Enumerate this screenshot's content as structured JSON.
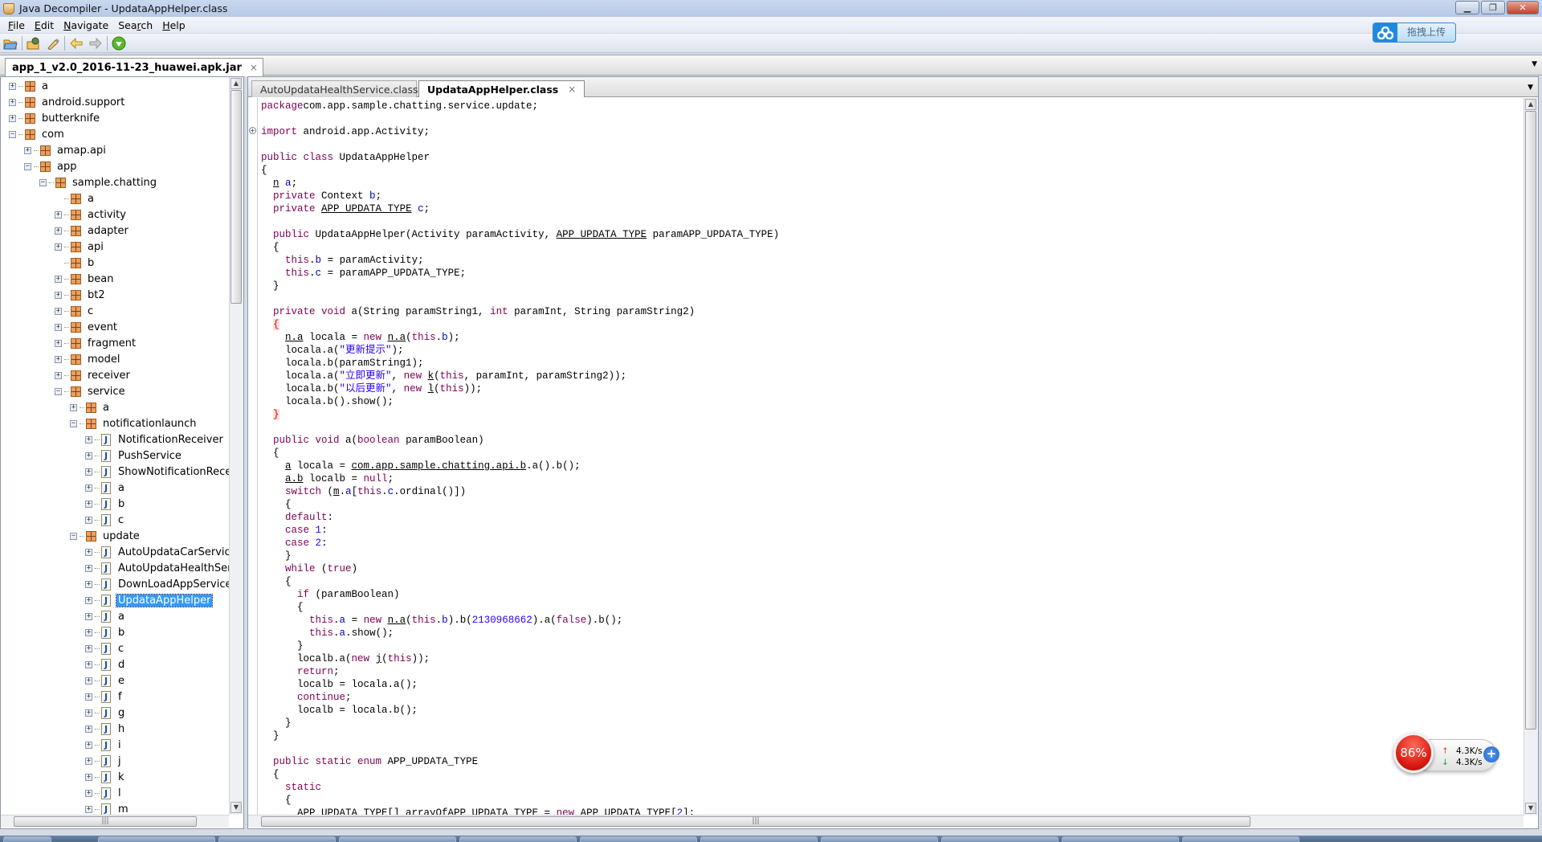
{
  "window": {
    "title": "Java Decompiler - UpdataAppHelper.class",
    "min": "▁",
    "restore": "❐",
    "close": "✕"
  },
  "menu": [
    {
      "mn": "F",
      "rest": "ile"
    },
    {
      "mn": "E",
      "rest": "dit"
    },
    {
      "mn": "N",
      "rest": "avigate"
    },
    {
      "pre": "Sea",
      "mn": "r",
      "rest": "ch"
    },
    {
      "mn": "H",
      "rest": "elp"
    }
  ],
  "toolbar": [
    "open-file-icon",
    "open-type-icon",
    "search-icon",
    "back-icon",
    "forward-icon",
    "jd-online-icon"
  ],
  "upload_widget": {
    "label": "拖拽上传"
  },
  "outer_tab": {
    "label": "app_1_v2.0_2016-11-23_huawei.apk.jar",
    "close": "×"
  },
  "tree": [
    {
      "l": 0,
      "t": "pkg",
      "e": "+",
      "label": "a"
    },
    {
      "l": 0,
      "t": "pkg",
      "e": "+",
      "label": "android.support"
    },
    {
      "l": 0,
      "t": "pkg",
      "e": "+",
      "label": "butterknife"
    },
    {
      "l": 0,
      "t": "pkg",
      "e": "-",
      "label": "com"
    },
    {
      "l": 1,
      "t": "pkg",
      "e": "+",
      "label": "amap.api"
    },
    {
      "l": 1,
      "t": "pkg",
      "e": "-",
      "label": "app"
    },
    {
      "l": 2,
      "t": "pkg",
      "e": "-",
      "label": "sample.chatting"
    },
    {
      "l": 3,
      "t": "pkg",
      "e": "",
      "label": "a"
    },
    {
      "l": 3,
      "t": "pkg",
      "e": "+",
      "label": "activity"
    },
    {
      "l": 3,
      "t": "pkg",
      "e": "+",
      "label": "adapter"
    },
    {
      "l": 3,
      "t": "pkg",
      "e": "+",
      "label": "api"
    },
    {
      "l": 3,
      "t": "pkg",
      "e": "",
      "label": "b"
    },
    {
      "l": 3,
      "t": "pkg",
      "e": "+",
      "label": "bean"
    },
    {
      "l": 3,
      "t": "pkg",
      "e": "+",
      "label": "bt2"
    },
    {
      "l": 3,
      "t": "pkg",
      "e": "+",
      "label": "c"
    },
    {
      "l": 3,
      "t": "pkg",
      "e": "+",
      "label": "event"
    },
    {
      "l": 3,
      "t": "pkg",
      "e": "+",
      "label": "fragment"
    },
    {
      "l": 3,
      "t": "pkg",
      "e": "+",
      "label": "model"
    },
    {
      "l": 3,
      "t": "pkg",
      "e": "+",
      "label": "receiver"
    },
    {
      "l": 3,
      "t": "pkg",
      "e": "-",
      "label": "service"
    },
    {
      "l": 4,
      "t": "pkg",
      "e": "+",
      "label": "a"
    },
    {
      "l": 4,
      "t": "pkg",
      "e": "-",
      "label": "notificationlaunch"
    },
    {
      "l": 5,
      "t": "cls",
      "e": "+",
      "label": "NotificationReceiver"
    },
    {
      "l": 5,
      "t": "cls",
      "e": "+",
      "label": "PushService"
    },
    {
      "l": 5,
      "t": "cls",
      "e": "+",
      "label": "ShowNotificationReceive"
    },
    {
      "l": 5,
      "t": "cls",
      "e": "+",
      "label": "a"
    },
    {
      "l": 5,
      "t": "cls",
      "e": "+",
      "label": "b"
    },
    {
      "l": 5,
      "t": "cls",
      "e": "+",
      "label": "c"
    },
    {
      "l": 4,
      "t": "pkg",
      "e": "-",
      "label": "update"
    },
    {
      "l": 5,
      "t": "cls",
      "e": "+",
      "label": "AutoUpdataCarService"
    },
    {
      "l": 5,
      "t": "cls",
      "e": "+",
      "label": "AutoUpdataHealthServic"
    },
    {
      "l": 5,
      "t": "cls",
      "e": "+",
      "label": "DownLoadAppService"
    },
    {
      "l": 5,
      "t": "cls",
      "e": "+",
      "label": "UpdataAppHelper",
      "selected": true
    },
    {
      "l": 5,
      "t": "cls",
      "e": "+",
      "label": "a"
    },
    {
      "l": 5,
      "t": "cls",
      "e": "+",
      "label": "b"
    },
    {
      "l": 5,
      "t": "cls",
      "e": "+",
      "label": "c"
    },
    {
      "l": 5,
      "t": "cls",
      "e": "+",
      "label": "d"
    },
    {
      "l": 5,
      "t": "cls",
      "e": "+",
      "label": "e"
    },
    {
      "l": 5,
      "t": "cls",
      "e": "+",
      "label": "f"
    },
    {
      "l": 5,
      "t": "cls",
      "e": "+",
      "label": "g"
    },
    {
      "l": 5,
      "t": "cls",
      "e": "+",
      "label": "h"
    },
    {
      "l": 5,
      "t": "cls",
      "e": "+",
      "label": "i"
    },
    {
      "l": 5,
      "t": "cls",
      "e": "+",
      "label": "j"
    },
    {
      "l": 5,
      "t": "cls",
      "e": "+",
      "label": "k"
    },
    {
      "l": 5,
      "t": "cls",
      "e": "+",
      "label": "l"
    },
    {
      "l": 5,
      "t": "cls",
      "e": "+",
      "label": "m"
    }
  ],
  "editor_tabs": [
    {
      "label": "AutoUpdataHealthService.class",
      "active": false
    },
    {
      "label": "UpdataAppHelper.class",
      "active": true,
      "close": "×"
    }
  ],
  "code_colors": {
    "keyword": "#7f0055",
    "field": "#0000c0",
    "string": "#2a00ff"
  },
  "code": [
    [
      [
        "k",
        "package"
      ],
      [
        "",
        "com.app.sample.chatting.service.update;"
      ]
    ],
    [],
    [
      [
        "k",
        "import"
      ],
      [
        "",
        " android.app.Activity;"
      ]
    ],
    [],
    [
      [
        "k",
        "public class"
      ],
      [
        "",
        " UpdataAppHelper"
      ]
    ],
    [
      [
        "",
        "{"
      ]
    ],
    [
      [
        "",
        "  "
      ],
      [
        "u",
        "n"
      ],
      [
        "",
        " "
      ],
      [
        "f",
        "a"
      ],
      [
        "",
        ";"
      ]
    ],
    [
      [
        "",
        "  "
      ],
      [
        "k",
        "private"
      ],
      [
        "",
        " Context "
      ],
      [
        "f",
        "b"
      ],
      [
        "",
        ";"
      ]
    ],
    [
      [
        "",
        "  "
      ],
      [
        "k",
        "private"
      ],
      [
        "",
        " "
      ],
      [
        "u",
        "APP_UPDATA_TYPE"
      ],
      [
        "",
        " "
      ],
      [
        "f",
        "c"
      ],
      [
        "",
        ";"
      ]
    ],
    [],
    [
      [
        "",
        "  "
      ],
      [
        "k",
        "public"
      ],
      [
        "",
        " UpdataAppHelper(Activity paramActivity, "
      ],
      [
        "u",
        "APP_UPDATA_TYPE"
      ],
      [
        "",
        " paramAPP_UPDATA_TYPE)"
      ]
    ],
    [
      [
        "",
        "  {"
      ]
    ],
    [
      [
        "",
        "    "
      ],
      [
        "k",
        "this"
      ],
      [
        "",
        "."
      ],
      [
        "f",
        "b"
      ],
      [
        "",
        " = paramActivity;"
      ]
    ],
    [
      [
        "",
        "    "
      ],
      [
        "k",
        "this"
      ],
      [
        "",
        "."
      ],
      [
        "f",
        "c"
      ],
      [
        "",
        " = paramAPP_UPDATA_TYPE;"
      ]
    ],
    [
      [
        "",
        "  }"
      ]
    ],
    [],
    [
      [
        "",
        "  "
      ],
      [
        "k",
        "private void"
      ],
      [
        "",
        " a(String paramString1, "
      ],
      [
        "k",
        "int"
      ],
      [
        "",
        " paramInt, String paramString2)"
      ]
    ],
    [
      [
        "",
        "  "
      ],
      [
        "rb",
        "{"
      ]
    ],
    [
      [
        "",
        "    "
      ],
      [
        "u",
        "n.a"
      ],
      [
        "",
        " locala = "
      ],
      [
        "k",
        "new"
      ],
      [
        "",
        " "
      ],
      [
        "u",
        "n.a"
      ],
      [
        "",
        "("
      ],
      [
        "k",
        "this"
      ],
      [
        "",
        "."
      ],
      [
        "f",
        "b"
      ],
      [
        "",
        ");"
      ]
    ],
    [
      [
        "",
        "    locala.a("
      ],
      [
        "s",
        "\"更新提示\""
      ],
      [
        "",
        ");"
      ]
    ],
    [
      [
        "",
        "    locala.b(paramString1);"
      ]
    ],
    [
      [
        "",
        "    locala.a("
      ],
      [
        "s",
        "\"立即更新\""
      ],
      [
        "",
        ", "
      ],
      [
        "k",
        "new"
      ],
      [
        "",
        " "
      ],
      [
        "u",
        "k"
      ],
      [
        "",
        "("
      ],
      [
        "k",
        "this"
      ],
      [
        "",
        ", paramInt, paramString2));"
      ]
    ],
    [
      [
        "",
        "    locala.b("
      ],
      [
        "s",
        "\"以后更新\""
      ],
      [
        "",
        ", "
      ],
      [
        "k",
        "new"
      ],
      [
        "",
        " "
      ],
      [
        "u",
        "l"
      ],
      [
        "",
        "("
      ],
      [
        "k",
        "this"
      ],
      [
        "",
        "));"
      ]
    ],
    [
      [
        "",
        "    locala.b().show();"
      ]
    ],
    [
      [
        "",
        "  "
      ],
      [
        "rb",
        "}"
      ]
    ],
    [],
    [
      [
        "",
        "  "
      ],
      [
        "k",
        "public void"
      ],
      [
        "",
        " a("
      ],
      [
        "k",
        "boolean"
      ],
      [
        "",
        " paramBoolean)"
      ]
    ],
    [
      [
        "",
        "  {"
      ]
    ],
    [
      [
        "",
        "    "
      ],
      [
        "u",
        "a"
      ],
      [
        "",
        " locala = "
      ],
      [
        "u",
        "com.app.sample.chatting.api.b"
      ],
      [
        "",
        ".a().b();"
      ]
    ],
    [
      [
        "",
        "    "
      ],
      [
        "u",
        "a.b"
      ],
      [
        "",
        " localb = "
      ],
      [
        "k",
        "null"
      ],
      [
        "",
        ";"
      ]
    ],
    [
      [
        "",
        "    "
      ],
      [
        "k",
        "switch"
      ],
      [
        "",
        " ("
      ],
      [
        "u",
        "m"
      ],
      [
        "",
        "."
      ],
      [
        "f",
        "a"
      ],
      [
        "",
        "["
      ],
      [
        "k",
        "this"
      ],
      [
        "",
        "."
      ],
      [
        "f",
        "c"
      ],
      [
        "",
        ".ordinal()])"
      ]
    ],
    [
      [
        "",
        "    {"
      ]
    ],
    [
      [
        "",
        "    "
      ],
      [
        "k",
        "default"
      ],
      [
        "",
        ":"
      ]
    ],
    [
      [
        "",
        "    "
      ],
      [
        "k",
        "case"
      ],
      [
        "",
        " "
      ],
      [
        "n",
        "1"
      ],
      [
        "",
        ":"
      ]
    ],
    [
      [
        "",
        "    "
      ],
      [
        "k",
        "case"
      ],
      [
        "",
        " "
      ],
      [
        "n",
        "2"
      ],
      [
        "",
        ":"
      ]
    ],
    [
      [
        "",
        "    }"
      ]
    ],
    [
      [
        "",
        "    "
      ],
      [
        "k",
        "while"
      ],
      [
        "",
        " ("
      ],
      [
        "k",
        "true"
      ],
      [
        "",
        ")"
      ]
    ],
    [
      [
        "",
        "    {"
      ]
    ],
    [
      [
        "",
        "      "
      ],
      [
        "k",
        "if"
      ],
      [
        "",
        " (paramBoolean)"
      ]
    ],
    [
      [
        "",
        "      {"
      ]
    ],
    [
      [
        "",
        "        "
      ],
      [
        "k",
        "this"
      ],
      [
        "",
        "."
      ],
      [
        "f",
        "a"
      ],
      [
        "",
        " = "
      ],
      [
        "k",
        "new"
      ],
      [
        "",
        " "
      ],
      [
        "u",
        "n.a"
      ],
      [
        "",
        "("
      ],
      [
        "k",
        "this"
      ],
      [
        "",
        "."
      ],
      [
        "f",
        "b"
      ],
      [
        "",
        ").b("
      ],
      [
        "n",
        "2130968662"
      ],
      [
        "",
        ").a("
      ],
      [
        "k",
        "false"
      ],
      [
        "",
        ").b();"
      ]
    ],
    [
      [
        "",
        "        "
      ],
      [
        "k",
        "this"
      ],
      [
        "",
        "."
      ],
      [
        "f",
        "a"
      ],
      [
        "",
        ".show();"
      ]
    ],
    [
      [
        "",
        "      }"
      ]
    ],
    [
      [
        "",
        "      localb.a("
      ],
      [
        "k",
        "new"
      ],
      [
        "",
        " "
      ],
      [
        "u",
        "j"
      ],
      [
        "",
        "("
      ],
      [
        "k",
        "this"
      ],
      [
        "",
        "));"
      ]
    ],
    [
      [
        "",
        "      "
      ],
      [
        "k",
        "return"
      ],
      [
        "",
        ";"
      ]
    ],
    [
      [
        "",
        "      localb = locala.a();"
      ]
    ],
    [
      [
        "",
        "      "
      ],
      [
        "k",
        "continue"
      ],
      [
        "",
        ";"
      ]
    ],
    [
      [
        "",
        "      localb = locala.b();"
      ]
    ],
    [
      [
        "",
        "    }"
      ]
    ],
    [
      [
        "",
        "  }"
      ]
    ],
    [],
    [
      [
        "",
        "  "
      ],
      [
        "k",
        "public static enum"
      ],
      [
        "",
        " APP_UPDATA_TYPE"
      ]
    ],
    [
      [
        "",
        "  {"
      ]
    ],
    [
      [
        "",
        "    "
      ],
      [
        "k",
        "static"
      ]
    ],
    [
      [
        "",
        "    {"
      ]
    ],
    [
      [
        "",
        "      APP_UPDATA_TYPE[] arrayOfAPP_UPDATA_TYPE = "
      ],
      [
        "k",
        "new"
      ],
      [
        "",
        " APP_UPDATA_TYPE["
      ],
      [
        "n",
        "2"
      ],
      [
        "",
        "];"
      ]
    ]
  ],
  "net_widget": {
    "percent": "86%",
    "up": "4.3K/s",
    "down": "4.3K/s",
    "up_arrow": "↑",
    "down_arrow": "↓",
    "add": "+",
    "colors": {
      "ball": "#d81a10",
      "up": "#e04a30",
      "down": "#2a9a3a"
    }
  }
}
